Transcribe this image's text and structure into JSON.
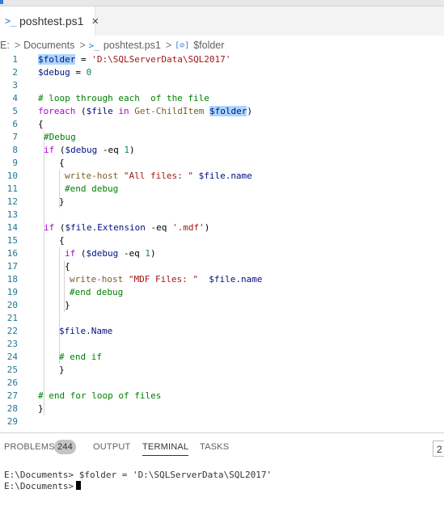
{
  "tab": {
    "label": "poshtest.ps1",
    "close": "×",
    "icon": "powershell-icon"
  },
  "breadcrumb": {
    "root": "E:",
    "folder": "Documents",
    "file": "poshtest.ps1",
    "symbol": "$folder"
  },
  "editor": {
    "line_numbers": [
      "1",
      "2",
      "3",
      "4",
      "5",
      "6",
      "7",
      "8",
      "9",
      "10",
      "11",
      "12",
      "13",
      "14",
      "15",
      "16",
      "17",
      "18",
      "19",
      "20",
      "21",
      "22",
      "23",
      "24",
      "25",
      "26",
      "27",
      "28",
      "29"
    ],
    "l1": {
      "var": "$folder",
      "op": " = ",
      "str": "'D:\\SQLServerData\\SQL2017'"
    },
    "l2": {
      "var": "$debug",
      "op": " = ",
      "num": "0"
    },
    "l4": "# loop through each  of the file",
    "l5": {
      "kw": "foreach",
      "p1": " (",
      "var": "$file",
      "in": " in ",
      "cmd": "Get-ChildItem",
      "sp": " ",
      "var2": "$folder",
      "p2": ")"
    },
    "l6": "{",
    "l7": "#Debug",
    "l8": {
      "kw": "if",
      "p1": " (",
      "var": "$debug",
      "op": " -eq ",
      "num": "1",
      "p2": ")"
    },
    "l9": "{",
    "l10": {
      "cmd": "write-host",
      "sp": " ",
      "str": "\"All files: \"",
      "sp2": " ",
      "var": "$file.name"
    },
    "l11": "#end debug",
    "l12": "}",
    "l14": {
      "kw": "if",
      "p1": " (",
      "var": "$file.Extension",
      "op": " -eq ",
      "str": "'.mdf'",
      "p2": ")"
    },
    "l15": "{",
    "l16": {
      "kw": "if",
      "p1": " (",
      "var": "$debug",
      "op": " -eq ",
      "num": "1",
      "p2": ")"
    },
    "l17": "{",
    "l18": {
      "cmd": "write-host",
      "sp": " ",
      "str": "\"MDF Files: \"",
      "sp2": "  ",
      "var": "$file.name"
    },
    "l19": "#end debug",
    "l20": "}",
    "l22": "$file.Name",
    "l24": "# end if",
    "l25": "}",
    "l27": "# end for loop of files",
    "l28": "}"
  },
  "panel": {
    "tabs": [
      "PROBLEMS",
      "OUTPUT",
      "TERMINAL",
      "TASKS"
    ],
    "problems_count": "244",
    "right_box": "2",
    "terminal_line1": "E:\\Documents> $folder = 'D:\\SQLServerData\\SQL2017'",
    "terminal_prompt": "E:\\Documents>"
  }
}
